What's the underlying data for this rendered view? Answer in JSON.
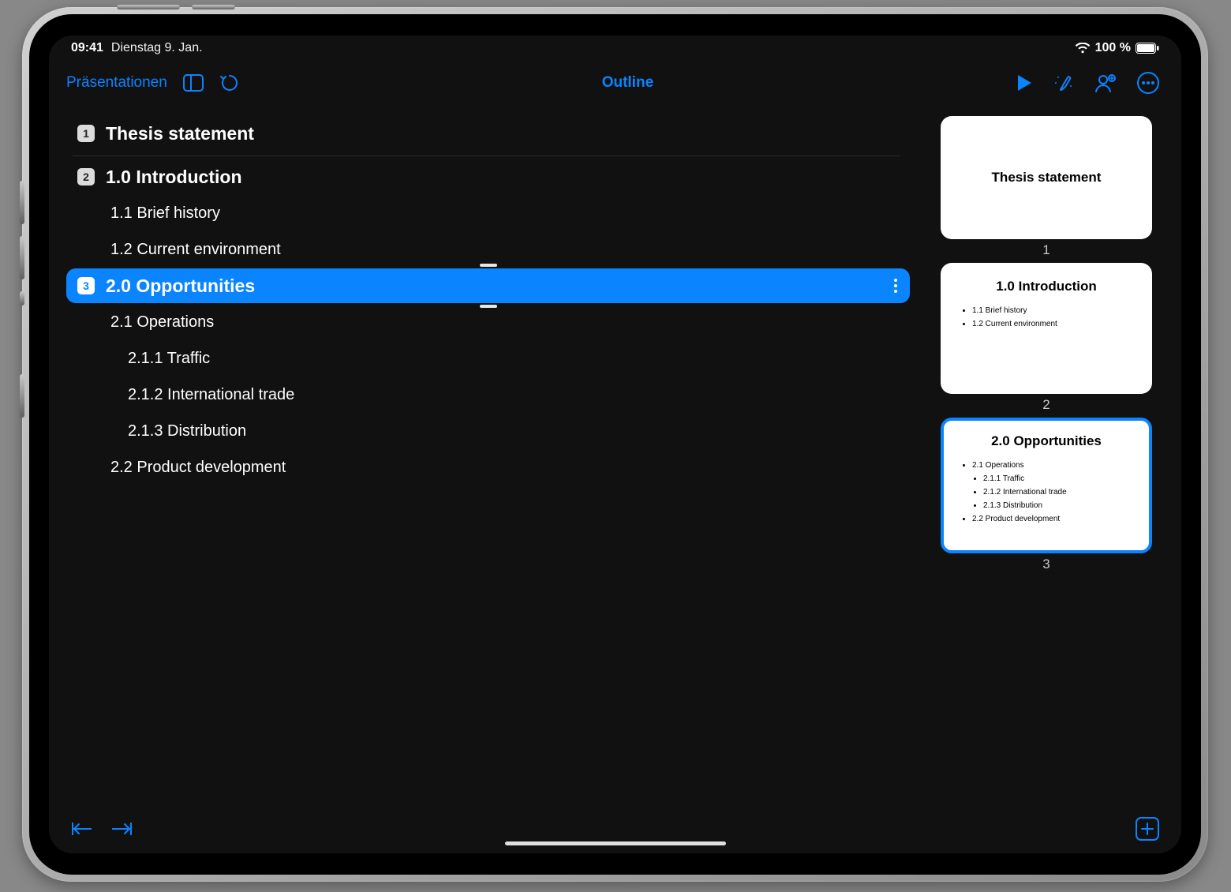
{
  "status": {
    "time": "09:41",
    "date": "Dienstag 9. Jan.",
    "battery": "100 %"
  },
  "toolbar": {
    "back_label": "Präsentationen",
    "title": "Outline"
  },
  "outline": {
    "rows": [
      {
        "badge": "1",
        "title": "Thesis statement"
      },
      {
        "badge": "2",
        "title": "1.0 Introduction",
        "children": [
          {
            "text": "1.1 Brief history"
          },
          {
            "text": "1.2 Current environment"
          }
        ]
      },
      {
        "badge": "3",
        "title": "2.0 Opportunities",
        "selected": true,
        "children": [
          {
            "text": "2.1 Operations",
            "children": [
              {
                "text": "2.1.1 Traffic"
              },
              {
                "text": "2.1.2 International trade"
              },
              {
                "text": "2.1.3 Distribution"
              }
            ]
          },
          {
            "text": "2.2 Product development"
          }
        ]
      }
    ]
  },
  "thumbs": {
    "0": {
      "title": "Thesis statement",
      "num": "1"
    },
    "1": {
      "title": "1.0 Introduction",
      "b0": "1.1 Brief history",
      "b1": "1.2 Current environment",
      "num": "2"
    },
    "2": {
      "title": "2.0 Opportunities",
      "b0": "2.1 Operations",
      "b0_0": "2.1.1 Traffic",
      "b0_1": "2.1.2 International trade",
      "b0_2": "2.1.3 Distribution",
      "b1": "2.2 Product development",
      "num": "3"
    }
  }
}
